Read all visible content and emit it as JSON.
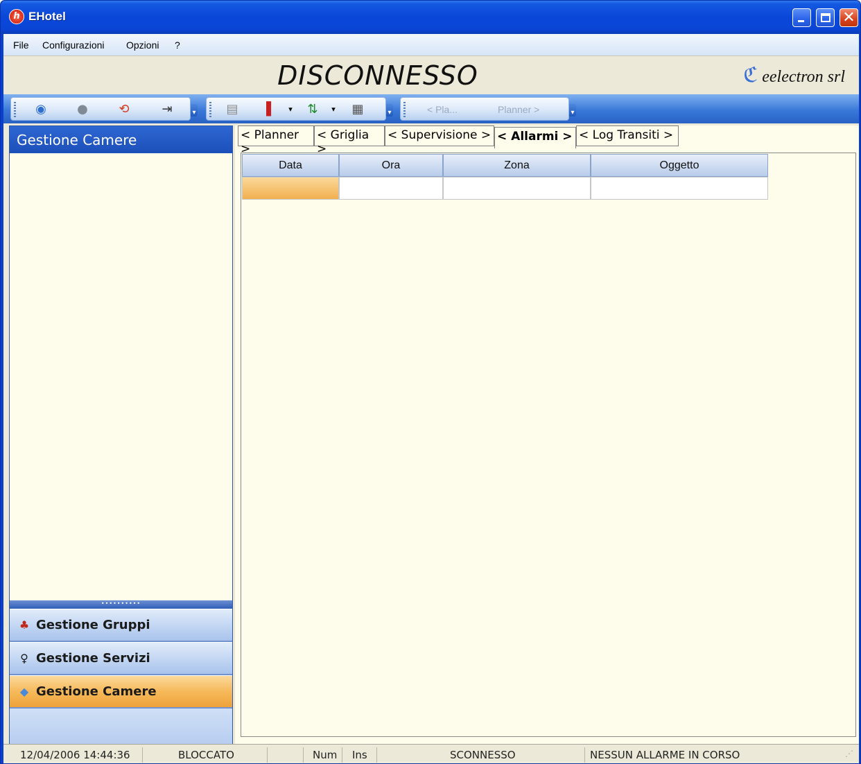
{
  "window": {
    "title": "EHotel"
  },
  "menu": [
    "File",
    "Configurazioni",
    "Opzioni",
    "?"
  ],
  "banner": {
    "status": "DISCONNESSO",
    "brand": "eelectron srl"
  },
  "toolbar": {
    "nav_prev": "< Pla...",
    "nav_next": "Planner >"
  },
  "left_panel": {
    "header": "Gestione Camere",
    "nav": [
      {
        "label": "Gestione Gruppi",
        "icon": "group-icon"
      },
      {
        "label": "Gestione Servizi",
        "icon": "service-icon"
      },
      {
        "label": "Gestione Camere",
        "icon": "room-icon",
        "active": true
      }
    ]
  },
  "tabs": [
    {
      "label": "< Planner >"
    },
    {
      "label": "< Griglia >"
    },
    {
      "label": "< Supervisione >"
    },
    {
      "label": "< Allarmi >",
      "active": true
    },
    {
      "label": "< Log Transiti >"
    }
  ],
  "grid": {
    "columns": [
      "Data",
      "Ora",
      "Zona",
      "Oggetto"
    ]
  },
  "status": {
    "datetime": "12/04/2006 14:44:36",
    "lock": "BLOCCATO",
    "num": "Num",
    "ins": "Ins",
    "connection": "SCONNESSO",
    "alarm": "NESSUN ALLARME IN CORSO"
  },
  "colors": {
    "accent": "#0a47d8",
    "active_nav": "#f6b95a",
    "panel_bg": "#fefdeb"
  }
}
